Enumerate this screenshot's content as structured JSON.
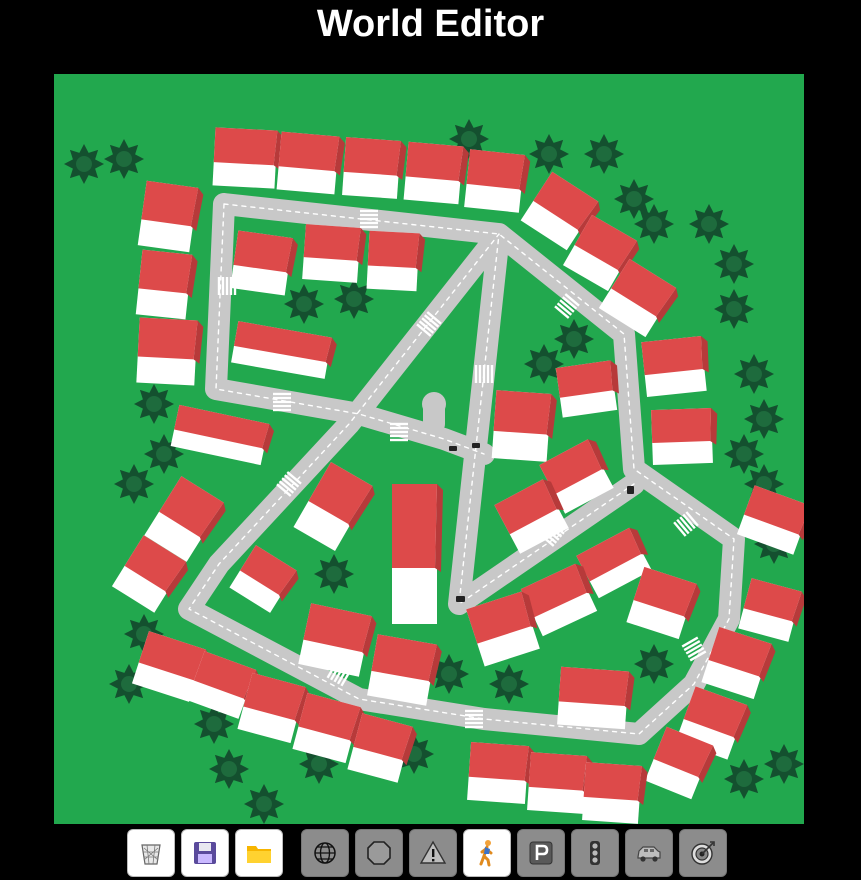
{
  "page": {
    "title": "World Editor"
  },
  "colors": {
    "background": "#000000",
    "grass": "#22a84e",
    "road": "#c8c8c8",
    "road_dash": "#ffffff",
    "roof": "#dd4a4a",
    "wall": "#ffffff",
    "tree": "#14502f",
    "tool_inactive": "#8c8c8c",
    "tool_active": "#ffffff"
  },
  "toolbar": {
    "file_buttons": [
      {
        "name": "dispose-button",
        "icon": "trash-bin-icon"
      },
      {
        "name": "save-button",
        "icon": "floppy-disk-icon"
      },
      {
        "name": "load-button",
        "icon": "folder-icon"
      }
    ],
    "mode_buttons": [
      {
        "name": "graph-mode-button",
        "icon": "globe-icon",
        "active": false
      },
      {
        "name": "stop-mode-button",
        "icon": "stop-sign-icon",
        "active": false
      },
      {
        "name": "yield-mode-button",
        "icon": "warning-sign-icon",
        "active": false
      },
      {
        "name": "crossing-mode-button",
        "icon": "pedestrian-icon",
        "active": true
      },
      {
        "name": "parking-mode-button",
        "icon": "parking-sign-icon",
        "active": false
      },
      {
        "name": "light-mode-button",
        "icon": "traffic-light-icon",
        "active": false
      },
      {
        "name": "start-mode-button",
        "icon": "car-icon",
        "active": false
      },
      {
        "name": "target-mode-button",
        "icon": "target-icon",
        "active": false
      }
    ]
  }
}
